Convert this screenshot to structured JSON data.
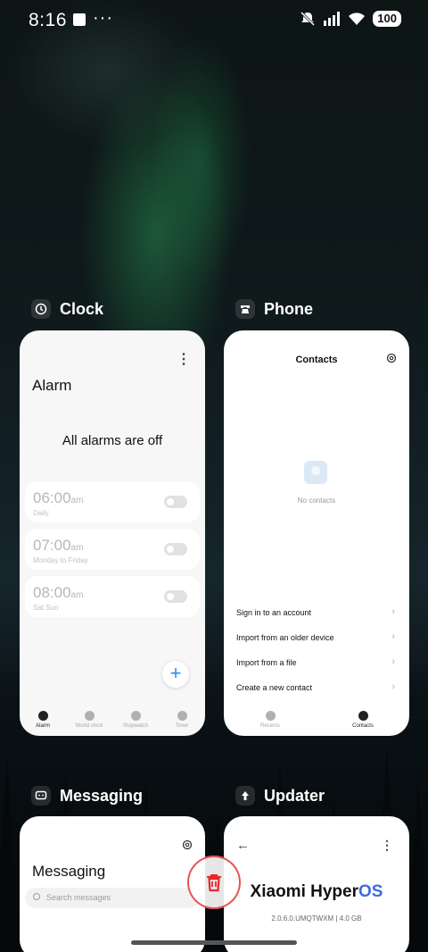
{
  "status": {
    "time": "8:16",
    "more": "···",
    "battery": "100"
  },
  "apps": {
    "clock": {
      "label": "Clock",
      "title": "Alarm",
      "empty": "All alarms are off",
      "alarms": [
        {
          "time": "06:00",
          "ampm": "am",
          "repeat": "Daily"
        },
        {
          "time": "07:00",
          "ampm": "am",
          "repeat": "Monday to Friday"
        },
        {
          "time": "08:00",
          "ampm": "am",
          "repeat": "Sat Sun"
        }
      ],
      "tabs": [
        "Alarm",
        "World clock",
        "Stopwatch",
        "Timer"
      ]
    },
    "phone": {
      "label": "Phone",
      "title": "Contacts",
      "empty": "No contacts",
      "menu": [
        "Sign in to an account",
        "Import from an older device",
        "Import from a file",
        "Create a new contact"
      ],
      "tabs": [
        "Recents",
        "Contacts"
      ]
    },
    "messaging": {
      "label": "Messaging",
      "title": "Messaging",
      "search_placeholder": "Search messages"
    },
    "updater": {
      "label": "Updater",
      "brand": "Xiaomi Hyper",
      "brand_os": "OS",
      "version": "2.0.6.0.UMQTWXM | 4.0 GB"
    }
  },
  "colors": {
    "accent": "#2f8df5",
    "os_blue": "#3d6be6",
    "trash_red": "#e62828"
  }
}
